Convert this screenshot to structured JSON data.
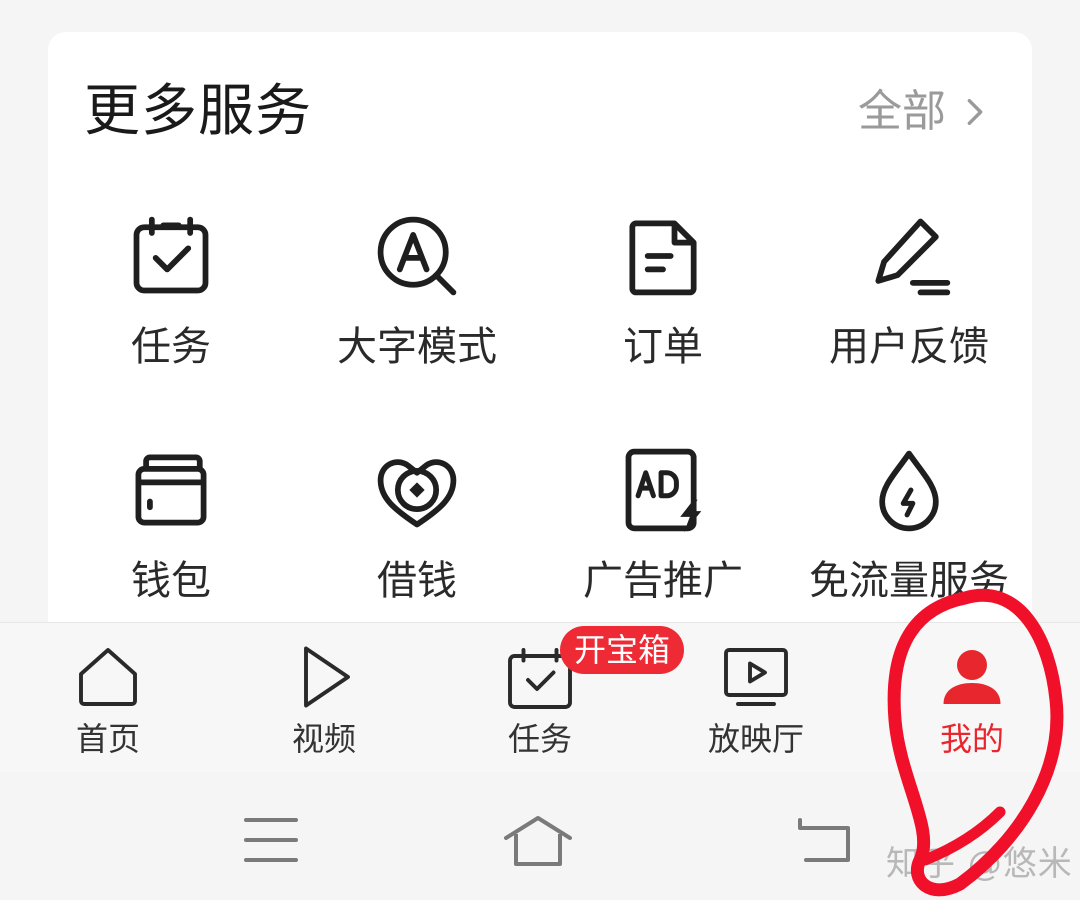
{
  "services": {
    "title": "更多服务",
    "more_label": "全部",
    "items": [
      {
        "label": "任务",
        "icon": "task-calendar-icon"
      },
      {
        "label": "大字模式",
        "icon": "large-font-icon"
      },
      {
        "label": "订单",
        "icon": "order-document-icon"
      },
      {
        "label": "用户反馈",
        "icon": "feedback-pen-icon"
      },
      {
        "label": "钱包",
        "icon": "wallet-icon"
      },
      {
        "label": "借钱",
        "icon": "loan-icon"
      },
      {
        "label": "广告推广",
        "icon": "ad-promotion-icon"
      },
      {
        "label": "免流量服务",
        "icon": "free-data-icon"
      }
    ]
  },
  "tabbar": {
    "tabs": [
      {
        "label": "首页",
        "icon": "home-icon",
        "active": false
      },
      {
        "label": "视频",
        "icon": "play-icon",
        "active": false
      },
      {
        "label": "任务",
        "icon": "task-calendar-icon",
        "active": false
      },
      {
        "label": "放映厅",
        "icon": "tv-play-icon",
        "active": false
      },
      {
        "label": "我的",
        "icon": "profile-icon",
        "active": true
      }
    ],
    "badge": "开宝箱"
  },
  "system_nav": {
    "buttons": [
      "menu-icon",
      "home-outline-icon",
      "back-icon"
    ]
  },
  "watermark": "知乎 @悠米",
  "colors": {
    "accent": "#e8262d",
    "badge": "#ee2b35",
    "annotation": "#f0102a"
  }
}
